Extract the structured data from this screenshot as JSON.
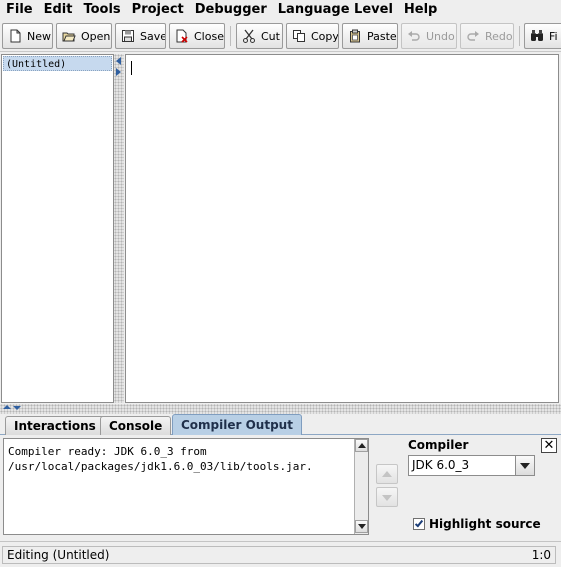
{
  "menubar": {
    "items": [
      {
        "label": "File"
      },
      {
        "label": "Edit"
      },
      {
        "label": "Tools"
      },
      {
        "label": "Project"
      },
      {
        "label": "Debugger"
      },
      {
        "label": "Language Level"
      },
      {
        "label": "Help"
      }
    ]
  },
  "toolbar": {
    "new": {
      "label": "New",
      "icon": "new-file-icon"
    },
    "open": {
      "label": "Open",
      "icon": "open-folder-icon"
    },
    "save": {
      "label": "Save",
      "icon": "save-disk-icon"
    },
    "close": {
      "label": "Close",
      "icon": "close-file-icon"
    },
    "cut": {
      "label": "Cut",
      "icon": "scissors-icon"
    },
    "copy": {
      "label": "Copy",
      "icon": "copy-icon"
    },
    "paste": {
      "label": "Paste",
      "icon": "paste-clipboard-icon"
    },
    "undo": {
      "label": "Undo",
      "icon": "undo-icon",
      "enabled": false
    },
    "redo": {
      "label": "Redo",
      "icon": "redo-icon",
      "enabled": false
    },
    "find": {
      "label": "Fi",
      "icon": "binoculars-icon"
    }
  },
  "documents": {
    "items": [
      {
        "label": "(Untitled)",
        "selected": true
      }
    ]
  },
  "editor": {
    "content": ""
  },
  "tabs": [
    {
      "label": "Interactions",
      "active": false
    },
    {
      "label": "Console",
      "active": false
    },
    {
      "label": "Compiler Output",
      "active": true
    }
  ],
  "compiler_output": {
    "lines": [
      "Compiler ready: JDK 6.0_3 from",
      "/usr/local/packages/jdk1.6.0_03/lib/tools.jar."
    ]
  },
  "compiler_panel": {
    "title": "Compiler",
    "selected": "JDK 6.0_3",
    "highlight_label": "Highlight source",
    "highlight_checked": true,
    "close_glyph": "✕"
  },
  "statusbar": {
    "message": "Editing (Untitled)",
    "position": "1:0"
  },
  "colors": {
    "active_tab": "#b8cfe5",
    "selection": "#c6d9ee",
    "arrow_blue": "#2f5fa0"
  }
}
